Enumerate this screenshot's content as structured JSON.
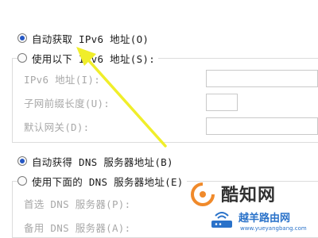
{
  "ipv6": {
    "auto_label": "自动获取 IPv6 地址(O)",
    "manual_label": "使用以下 IPv6 地址(S):",
    "fields": [
      {
        "label": "IPv6 地址(I):"
      },
      {
        "label": "子网前缀长度(U):"
      },
      {
        "label": "默认网关(D):"
      }
    ]
  },
  "dns": {
    "auto_label": "自动获得 DNS 服务器地址(B)",
    "manual_label": "使用下面的 DNS 服务器地址(E)",
    "fields": [
      {
        "label": "首选 DNS 服务器(P):"
      },
      {
        "label": "备用 DNS 服务器(A):"
      }
    ]
  },
  "watermark": {
    "brand": "酷知网",
    "brand2": "越羊路由网",
    "url": "www.yueyangbang.com"
  },
  "colors": {
    "arrow": "#f0ee2a",
    "radio_selected": "#2557c4",
    "disabled_text": "#a8a8a8",
    "watermark_blue": "#2a72c9",
    "watermark_orange": "#f08a2b"
  },
  "icons": [
    "radio-selected-icon",
    "radio-unselected-icon",
    "yellow-arrow-icon",
    "watermark-logo-icon",
    "router-icon"
  ]
}
